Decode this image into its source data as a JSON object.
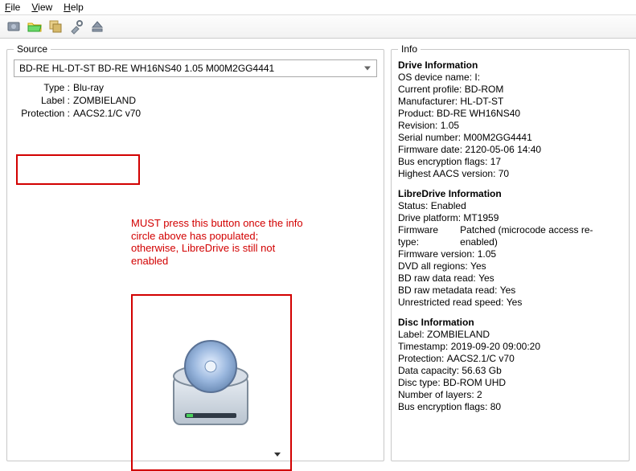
{
  "menu": {
    "file": "File",
    "view": "View",
    "help": "Help"
  },
  "toolbar_icons": [
    "new-open-icon",
    "folder-open-icon",
    "batch-icon",
    "tools-icon",
    "eject-icon"
  ],
  "source": {
    "legend": "Source",
    "drive_selected": "BD-RE HL-DT-ST BD-RE  WH16NS40 1.05 M00M2GG4441",
    "type_label": "Type :",
    "type_value": "Blu-ray",
    "label_label": "Label :",
    "label_value": "ZOMBIELAND",
    "protection_label": "Protection :",
    "protection_value": "AACS2.1/C v70"
  },
  "annotation": "MUST press this button once the info circle above has populated; otherwise, LibreDrive is still not enabled",
  "info": {
    "legend": "Info",
    "drive": {
      "title": "Drive Information",
      "rows": [
        {
          "k": "OS device name",
          "v": "I:"
        },
        {
          "k": "Current profile",
          "v": "BD-ROM"
        },
        {
          "k": "Manufacturer",
          "v": "HL-DT-ST"
        },
        {
          "k": "Product",
          "v": "BD-RE WH16NS40"
        },
        {
          "k": "Revision",
          "v": "1.05"
        },
        {
          "k": "Serial number",
          "v": "M00M2GG4441"
        },
        {
          "k": "Firmware date",
          "v": "2120-05-06 14:40"
        },
        {
          "k": "Bus encryption flags",
          "v": "17"
        },
        {
          "k": "Highest AACS version",
          "v": "70"
        }
      ]
    },
    "libre": {
      "title": "LibreDrive Information",
      "rows": [
        {
          "k": "Status",
          "v": "Enabled"
        },
        {
          "k": "Drive platform",
          "v": "MT1959"
        },
        {
          "k": "Firmware type",
          "v": "Patched (microcode access re-enabled)"
        },
        {
          "k": "Firmware version",
          "v": "1.05"
        },
        {
          "k": "DVD all regions",
          "v": "Yes"
        },
        {
          "k": "BD raw data read",
          "v": "Yes"
        },
        {
          "k": "BD raw metadata read",
          "v": "Yes"
        },
        {
          "k": "Unrestricted read speed",
          "v": "Yes"
        }
      ]
    },
    "disc": {
      "title": "Disc Information",
      "rows": [
        {
          "k": "Label",
          "v": "ZOMBIELAND"
        },
        {
          "k": "Timestamp",
          "v": "2019-09-20 09:00:20"
        },
        {
          "k": "Protection",
          "v": "AACS2.1/C v70"
        },
        {
          "k": "Data capacity",
          "v": "56.63 Gb"
        },
        {
          "k": "Disc type",
          "v": "BD-ROM UHD"
        },
        {
          "k": "Number of layers",
          "v": "2"
        },
        {
          "k": "Bus encryption flags",
          "v": "80"
        }
      ]
    }
  }
}
